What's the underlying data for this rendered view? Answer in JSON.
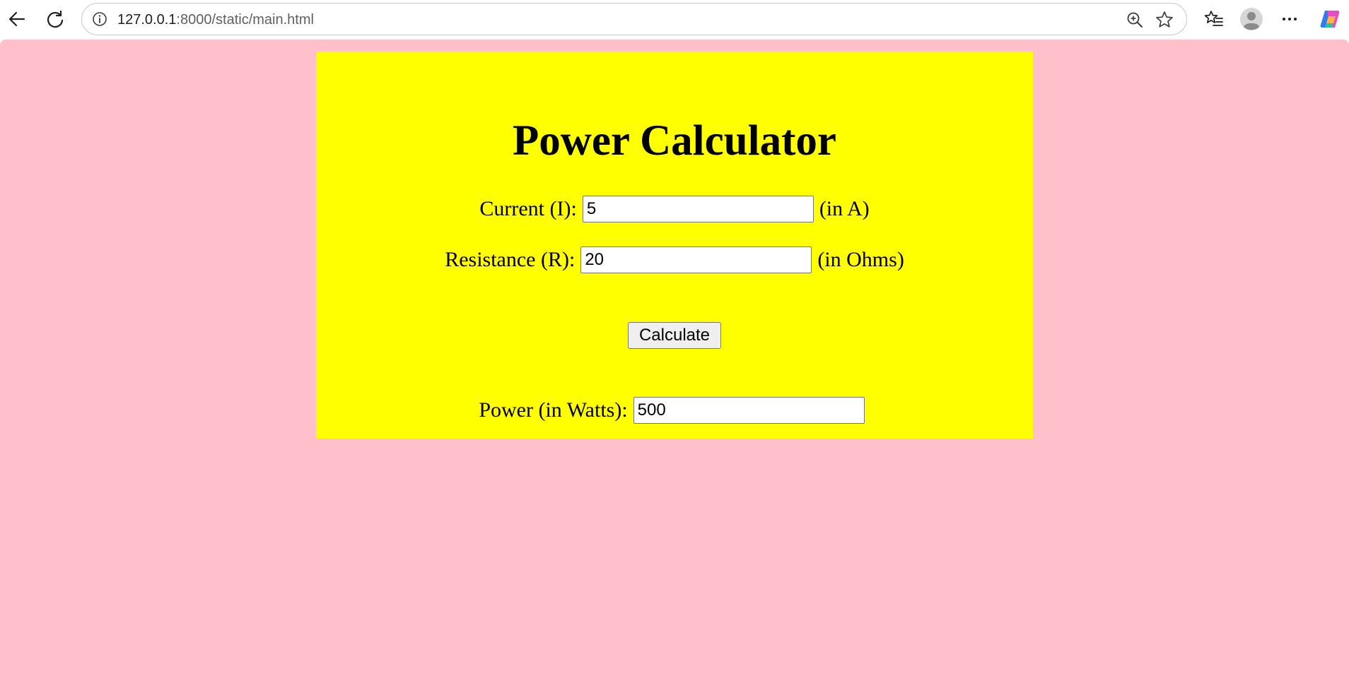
{
  "browser": {
    "url_host": "127.0.0.1",
    "url_path": ":8000/static/main.html"
  },
  "calculator": {
    "title": "Power Calculator",
    "current": {
      "label": "Current (I):",
      "value": "5",
      "unit": "(in A)"
    },
    "resistance": {
      "label": "Resistance (R):",
      "value": "20",
      "unit": "(in Ohms)"
    },
    "calculate_label": "Calculate",
    "power": {
      "label": "Power (in Watts):",
      "value": "500"
    }
  },
  "colors": {
    "page_background": "#ffc0cb",
    "panel_background": "#ffff00"
  }
}
